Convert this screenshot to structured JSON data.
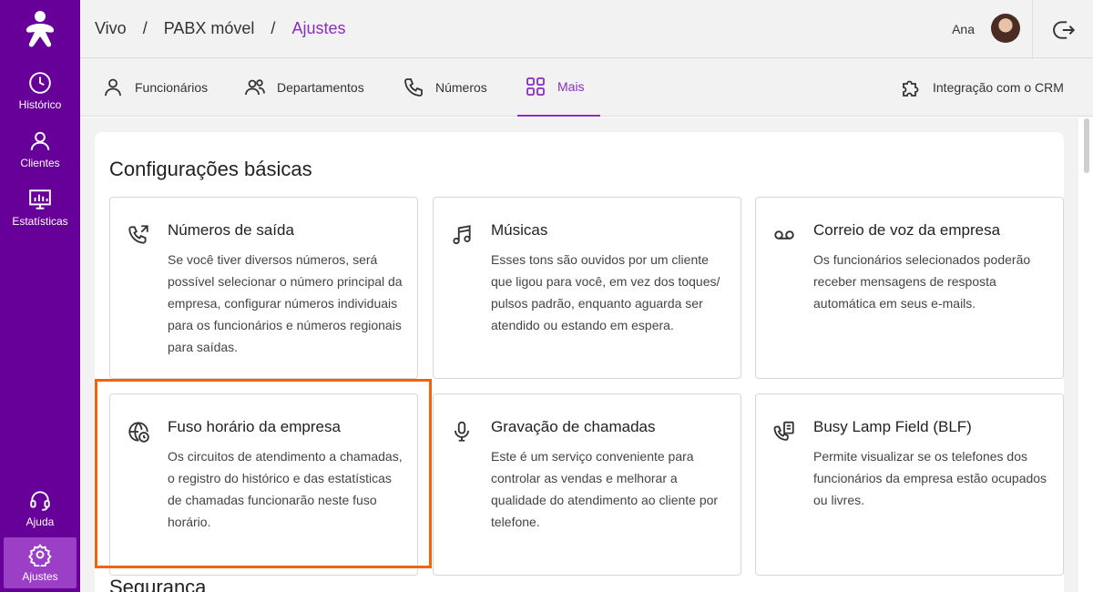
{
  "sidebar": {
    "items": [
      {
        "label": "Histórico",
        "icon": "clock-icon"
      },
      {
        "label": "Clientes",
        "icon": "person-icon"
      },
      {
        "label": "Estatísticas",
        "icon": "chart-monitor-icon"
      }
    ],
    "bottom_items": [
      {
        "label": "Ajuda",
        "icon": "headset-icon"
      },
      {
        "label": "Ajustes",
        "icon": "gear-icon",
        "active": true
      }
    ]
  },
  "header": {
    "breadcrumb": [
      "Vivo",
      "PABX móvel",
      "Ajustes"
    ],
    "separator": "/",
    "user_name": "Ana"
  },
  "tabs": [
    {
      "label": "Funcionários",
      "icon": "person-icon"
    },
    {
      "label": "Departamentos",
      "icon": "group-icon"
    },
    {
      "label": "Números",
      "icon": "phone-icon"
    },
    {
      "label": "Mais",
      "icon": "grid-icon",
      "active": true
    }
  ],
  "crm_link": {
    "label": "Integração com o CRM",
    "icon": "puzzle-icon"
  },
  "section_basic": {
    "title": "Configurações básicas",
    "cards": [
      {
        "title": "Números de saída",
        "icon": "outgoing-call-icon",
        "description": "Se você tiver diversos números, será possível selecionar o número principal da empresa, configurar números individuais para os funcionários e números regionais para saídas."
      },
      {
        "title": "Músicas",
        "icon": "music-note-icon",
        "description": "Esses tons são ouvidos por um cliente que ligou para você, em vez dos toques/ pulsos padrão, enquanto aguarda ser atendido ou estando em espera."
      },
      {
        "title": "Correio de voz da empresa",
        "icon": "voicemail-icon",
        "description": "Os funcionários selecionados poderão receber mensagens de resposta automática em seus e-mails."
      },
      {
        "title": "Fuso horário da empresa",
        "icon": "globe-clock-icon",
        "description": "Os circuitos de atendimento a chamadas, o registro do histórico e das estatísticas de chamadas funcionarão neste fuso horário."
      },
      {
        "title": "Gravação de chamadas",
        "icon": "microphone-icon",
        "description": "Este é um serviço conveniente para controlar as vendas e melhorar a qualidade do atendimento ao cliente por telefone."
      },
      {
        "title": "Busy Lamp Field (BLF)",
        "icon": "phone-list-icon",
        "description": "Permite visualizar se os telefones dos funcionários da empresa estão ocupados ou livres."
      }
    ]
  },
  "section_security": {
    "title": "Segurança"
  },
  "colors": {
    "brand": "#660099",
    "accent": "#8a2dc0",
    "highlight": "#f0640a"
  }
}
